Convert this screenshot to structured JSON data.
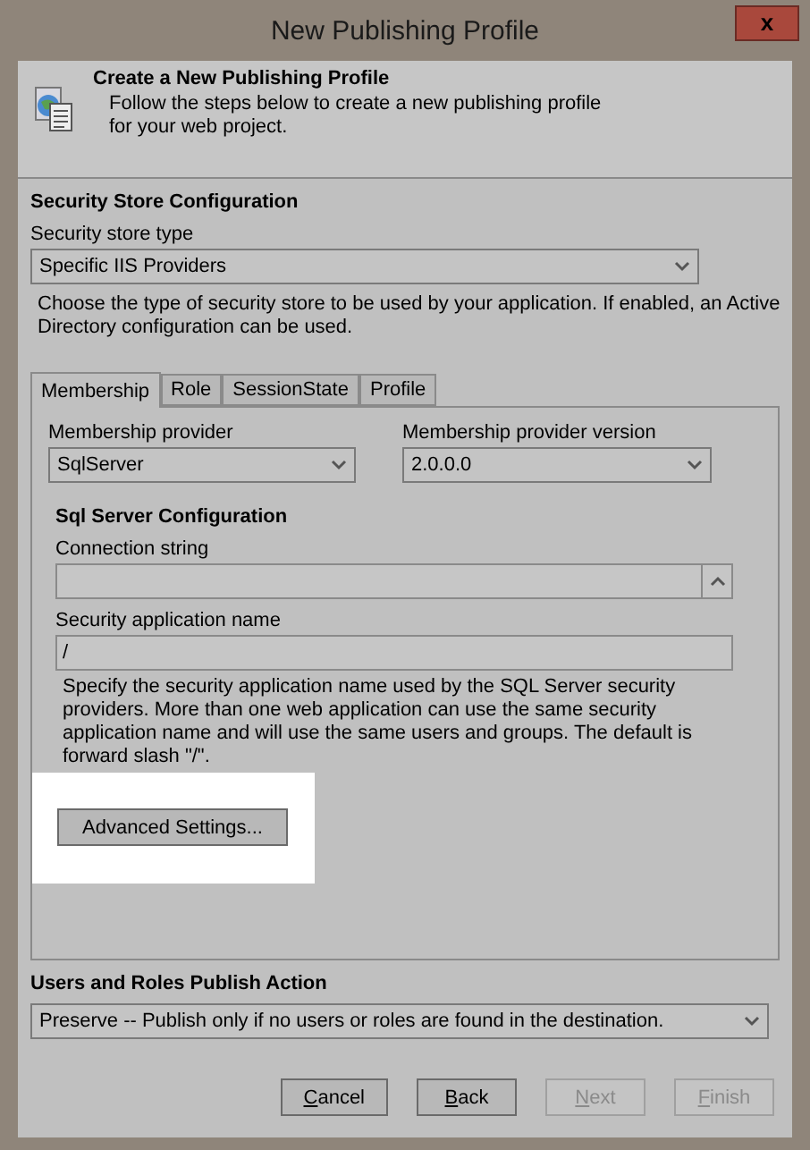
{
  "window": {
    "title": "New Publishing Profile",
    "close": "x"
  },
  "header": {
    "title": "Create a New Publishing Profile",
    "description": "Follow the steps below to create a new publishing profile for your web project."
  },
  "security_store": {
    "heading": "Security Store Configuration",
    "type_label": "Security store type",
    "type_value": "Specific IIS Providers",
    "description": "Choose the type of security store to be used by your application. If enabled, an Active Directory configuration can be used."
  },
  "tabs": [
    {
      "label": "Membership",
      "selected": true
    },
    {
      "label": "Role",
      "selected": false
    },
    {
      "label": "SessionState",
      "selected": false
    },
    {
      "label": "Profile",
      "selected": false
    }
  ],
  "membership": {
    "provider_label": "Membership provider",
    "provider_value": "SqlServer",
    "version_label": "Membership provider version",
    "version_value": "2.0.0.0",
    "sql_heading": "Sql Server Configuration",
    "connection_label": "Connection string",
    "app_name_label": "Security application name",
    "app_name_value": "/",
    "app_name_description": "Specify the security application name used by the SQL Server security providers. More than one web application can use the same security application name and will use the same users and groups. The default is forward slash \"/\".",
    "advanced_button": "Advanced Settings..."
  },
  "publish_action": {
    "heading": "Users and Roles Publish Action",
    "value": "Preserve -- Publish only if no users or roles are found in the destination."
  },
  "buttons": [
    {
      "label": "Cancel",
      "disabled": false,
      "mnemonic": true
    },
    {
      "label": "Back",
      "disabled": false,
      "mnemonic": true
    },
    {
      "label": "Next",
      "disabled": true,
      "mnemonic": true
    },
    {
      "label": "Finish",
      "disabled": true,
      "mnemonic": true
    }
  ]
}
